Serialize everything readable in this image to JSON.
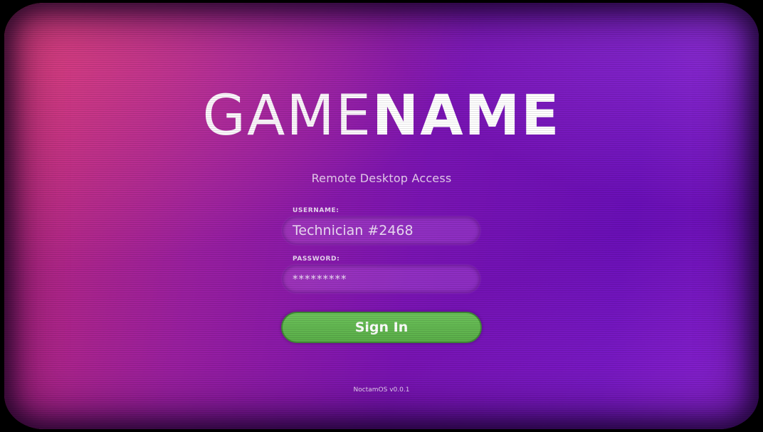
{
  "logo": {
    "light": "GAME",
    "bold": "NAME"
  },
  "subtitle": "Remote Desktop Access",
  "username": {
    "label": "USERNAME:",
    "value": "Technician #2468"
  },
  "password": {
    "label": "PASSWORD:",
    "value": "*********"
  },
  "signin_label": "Sign In",
  "version": "NoctamOS v0.0.1",
  "colors": {
    "background_left": "#c02a78",
    "background_right": "#6a0fb8",
    "button": "#5fb34d",
    "text": "#ffffff"
  }
}
